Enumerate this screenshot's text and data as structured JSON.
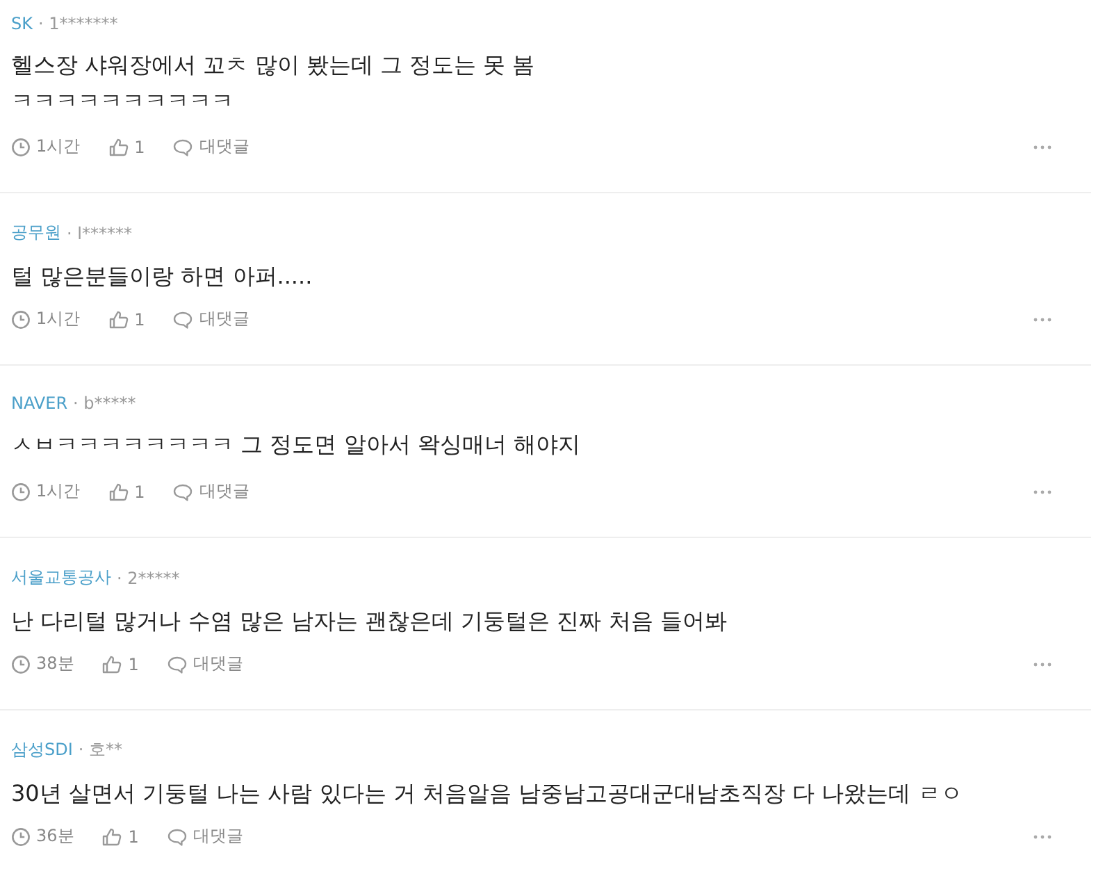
{
  "comments": [
    {
      "author": "SK",
      "user_id": "· 1*******",
      "lines": [
        "헬스장 샤워장에서 꼬ㅊ 많이 봤는데 그 정도는 못 봄",
        "ㅋㅋㅋㅋㅋㅋㅋㅋㅋㅋ"
      ],
      "time": "1시간",
      "likes": "1",
      "reply_label": "대댓글"
    },
    {
      "author": "공무원",
      "user_id": "· l******",
      "lines": [
        "털 많은분들이랑 하면 아퍼....."
      ],
      "time": "1시간",
      "likes": "1",
      "reply_label": "대댓글"
    },
    {
      "author": "NAVER",
      "user_id": "· b*****",
      "lines": [
        "ㅅㅂㅋㅋㅋㅋㅋㅋㅋㅋ 그 정도면 알아서 왁싱매너 해야지"
      ],
      "time": "1시간",
      "likes": "1",
      "reply_label": "대댓글"
    },
    {
      "author": "서울교통공사",
      "user_id": "· 2*****",
      "lines": [
        "난 다리털 많거나 수염 많은 남자는 괜찮은데 기둥털은 진짜 처음 들어봐"
      ],
      "time": "38분",
      "likes": "1",
      "reply_label": "대댓글"
    },
    {
      "author": "삼성SDI",
      "user_id": "· 호**",
      "lines": [
        "30년 살면서 기둥털 나는 사람 있다는 거 처음알음 남중남고공대군대남초직장 다 나왔는데 ㄹㅇ"
      ],
      "time": "36분",
      "likes": "1",
      "reply_label": "대댓글"
    }
  ]
}
